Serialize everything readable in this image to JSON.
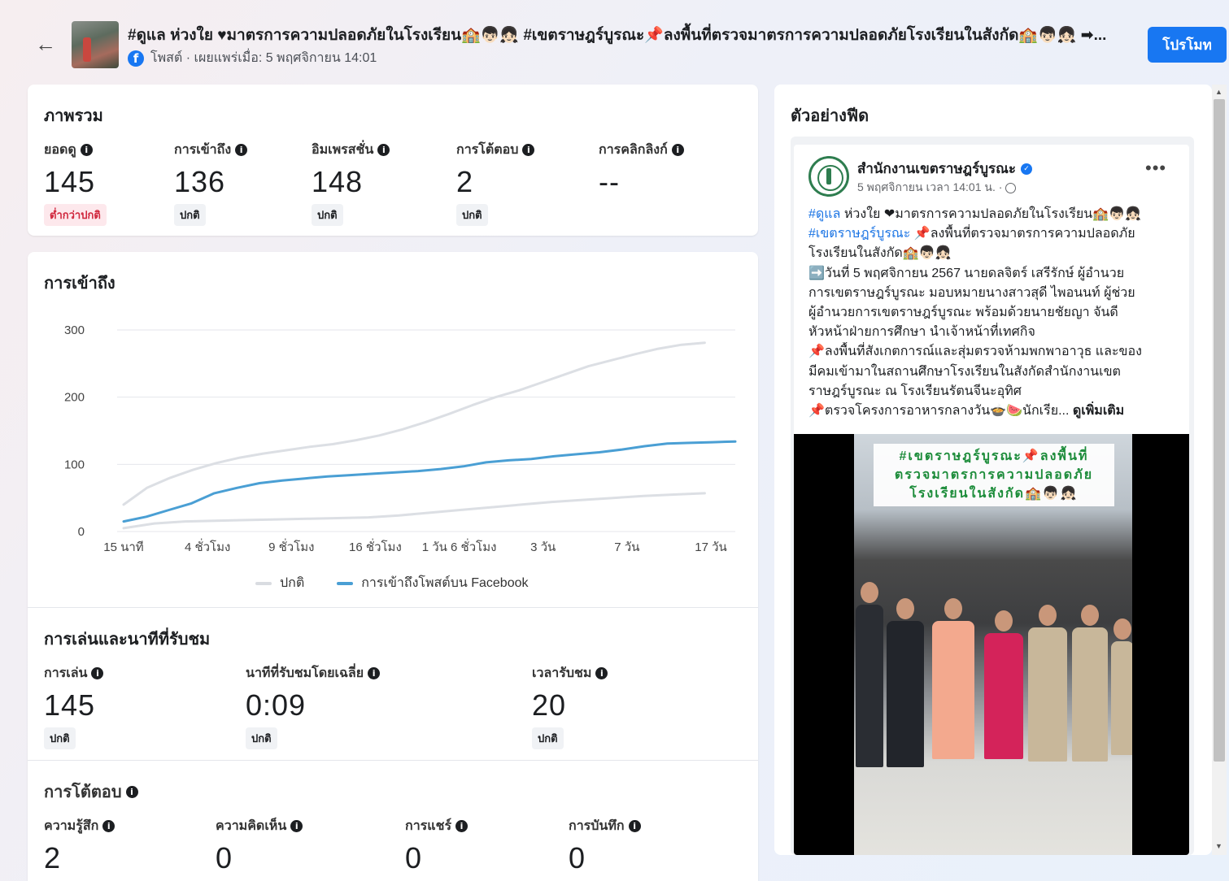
{
  "header": {
    "back_icon": "arrow-left-icon",
    "title": "#ดูแล ห่วงใย ♥มาตรการความปลอดภัยในโรงเรียน🏫👦🏻👧🏻 #เขตราษฎร์บูรณะ📌ลงพื้นที่ตรวจมาตรการความปลอดภัยโรงเรียนในสังกัด🏫👦🏻👧🏻 ➡...",
    "meta": "โพสต์ · เผยแพร่เมื่อ: 5 พฤศจิกายน 14:01",
    "promote_label": "โปรโมท"
  },
  "overview": {
    "title": "ภาพรวม",
    "metrics": [
      {
        "label": "ยอดดู",
        "value": "145",
        "status": "ต่ำกว่าปกติ",
        "status_type": "low"
      },
      {
        "label": "การเข้าถึง",
        "value": "136",
        "status": "ปกติ",
        "status_type": "normal"
      },
      {
        "label": "อิมเพรสชั่น",
        "value": "148",
        "status": "ปกติ",
        "status_type": "normal"
      },
      {
        "label": "การโต้ตอบ",
        "value": "2",
        "status": "ปกติ",
        "status_type": "normal"
      },
      {
        "label": "การคลิกลิงก์",
        "value": "--",
        "status": "",
        "status_type": "none"
      }
    ]
  },
  "reach": {
    "title": "การเข้าถึง"
  },
  "chart_data": {
    "type": "line",
    "title": "การเข้าถึง",
    "categories": [
      "15 นาที",
      "4 ชั่วโมง",
      "9 ชั่วโมง",
      "16 ชั่วโมง",
      "1 วัน 6 ชั่วโมง",
      "3 วัน",
      "7 วัน",
      "17 วัน"
    ],
    "y_ticks": [
      "0",
      "100",
      "200",
      "300"
    ],
    "ylim": [
      0,
      300
    ],
    "grid": true,
    "legend_position": "bottom",
    "series": [
      {
        "name": "ปกติ",
        "color": "#dcdfe4",
        "values": [
          40,
          65,
          80,
          92,
          102,
          110,
          116,
          121,
          126,
          130,
          136,
          143,
          152,
          163,
          175,
          188,
          200,
          210,
          222,
          234,
          246,
          255,
          264,
          272,
          278,
          281
        ]
      },
      {
        "name": "การเข้าถึงโพสต์บน Facebook",
        "color": "#4a9fd4",
        "values": [
          15,
          22,
          32,
          42,
          57,
          65,
          72,
          76,
          79,
          82,
          84,
          86,
          88,
          90,
          93,
          97,
          103,
          106,
          108,
          112,
          115,
          118,
          122,
          127,
          131,
          132,
          133,
          134
        ]
      },
      {
        "name": "ปกติ (ต่ำ)",
        "color": "#dcdfe4",
        "values": [
          5,
          12,
          15,
          16,
          17,
          18,
          19,
          20,
          21,
          24,
          28,
          32,
          36,
          40,
          44,
          47,
          50,
          53,
          55,
          57
        ]
      }
    ],
    "legend": [
      {
        "label": "ปกติ",
        "color": "#d9dce1"
      },
      {
        "label": "การเข้าถึงโพสต์บน Facebook",
        "color": "#4a9fd4"
      }
    ]
  },
  "plays": {
    "title": "การเล่นและนาทีที่รับชม",
    "metrics": [
      {
        "label": "การเล่น",
        "value": "145",
        "status": "ปกติ"
      },
      {
        "label": "นาทีที่รับชมโดยเฉลี่ย",
        "value": "0:09",
        "status": "ปกติ"
      },
      {
        "label": "เวลารับชม",
        "value": "20",
        "status": "ปกติ"
      }
    ]
  },
  "interactions": {
    "title": "การโต้ตอบ",
    "metrics": [
      {
        "label": "ความรู้สึก",
        "value": "2"
      },
      {
        "label": "ความคิดเห็น",
        "value": "0"
      },
      {
        "label": "การแชร์",
        "value": "0"
      },
      {
        "label": "การบันทึก",
        "value": "0"
      }
    ]
  },
  "preview": {
    "title": "ตัวอย่างฟีด",
    "page_name": "สำนักงานเขตราษฎร์บูรณะ",
    "post_time": "5 พฤศจิกายน เวลา 14:01 น. ·",
    "hashtag1": "#ดูแล",
    "line1_rest": " ห่วงใย ❤มาตรการความปลอดภัยในโรงเรียน🏫👦🏻👧🏻",
    "hashtag2": "#เขตราษฎร์บูรณะ",
    "line2_rest": " 📌ลงพื้นที่ตรวจมาตรการความปลอดภัย",
    "line3": "โรงเรียนในสังกัด🏫👦🏻👧🏻",
    "line4": "➡️วันที่ 5 พฤศจิกายน 2567 นายดลจิตร์ เสรีรักษ์ ผู้อำนวย",
    "line5": "การเขตราษฎร์บูรณะ มอบหมายนางสาวสุดี ไพอนนท์ ผู้ช่วย",
    "line6": "ผู้อำนวยการเขตราษฎร์บูรณะ พร้อมด้วยนายชัยญา จันดี",
    "line7": "หัวหน้าฝ่ายการศึกษา นำเจ้าหน้าที่เทศกิจ",
    "line8": "📌ลงพื้นที่สังเกตการณ์และสุ่มตรวจห้ามพกพาอาวุธ และของ",
    "line9": "มีคมเข้ามาในสถานศึกษาโรงเรียนในสังกัดสำนักงานเขต",
    "line10": "ราษฎร์บูรณะ ณ โรงเรียนรัตนจีนะอุทิศ",
    "line11": "📌ตรวจโครงการอาหารกลางวัน🍲🍉นักเรีย...",
    "see_more": "ดูเพิ่มเติม",
    "video_caption_1": "#เขตราษฎร์บูรณะ📌ลงพื้นที่",
    "video_caption_2": "ตรวจมาตรการความปลอดภัย",
    "video_caption_3": "โรงเรียนในสังกัด🏫👦🏻👧🏻"
  }
}
